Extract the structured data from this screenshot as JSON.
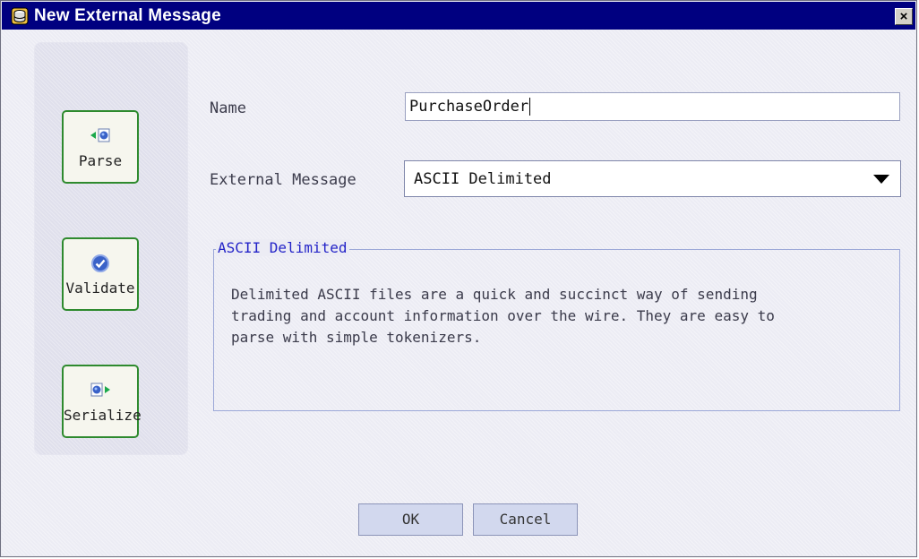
{
  "window": {
    "title": "New External Message",
    "close_glyph": "×"
  },
  "sidebar": {
    "items": [
      {
        "label": "Parse",
        "icon": "parse-icon"
      },
      {
        "label": "Validate",
        "icon": "validate-check-icon"
      },
      {
        "label": "Serialize",
        "icon": "serialize-icon"
      }
    ]
  },
  "form": {
    "name_label": "Name",
    "name_value": "PurchaseOrder",
    "external_label": "External Message",
    "external_value": "ASCII Delimited"
  },
  "group": {
    "title": "ASCII Delimited",
    "description_lines": [
      "Delimited ASCII files are a quick and succinct way of sending",
      "trading and account information over the wire. They are easy to",
      "parse with simple tokenizers."
    ]
  },
  "buttons": {
    "ok": "OK",
    "cancel": "Cancel"
  },
  "colors": {
    "titlebar": "#000080",
    "button_border": "#2e8a2e",
    "group_title": "#2424c8"
  }
}
